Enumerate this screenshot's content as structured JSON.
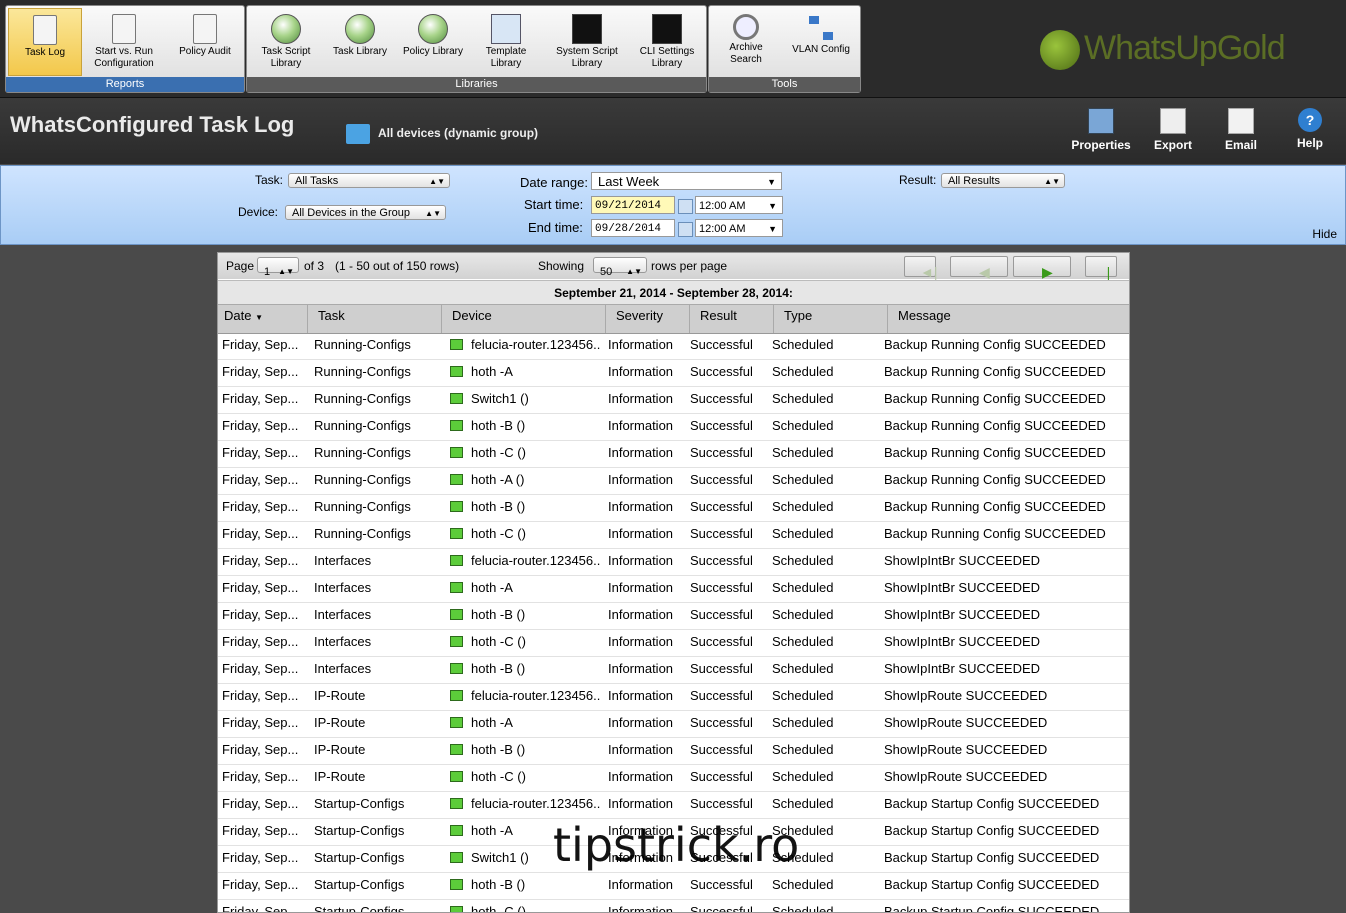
{
  "ribbon": {
    "groups": [
      {
        "label": "Reports",
        "buttons": [
          "Task Log",
          "Start vs. Run Configuration",
          "Policy Audit"
        ]
      },
      {
        "label": "Libraries",
        "buttons": [
          "Task Script Library",
          "Task Library",
          "Policy Library",
          "Template Library",
          "System Script Library",
          "CLI Settings Library"
        ]
      },
      {
        "label": "Tools",
        "buttons": [
          "Archive Search",
          "VLAN Config"
        ]
      }
    ],
    "active": "Task Log"
  },
  "logo": {
    "brand": "WhatsUpGold"
  },
  "titlebar": {
    "title": "WhatsConfigured Task Log",
    "group": "All devices (dynamic group)",
    "actions": [
      "Properties",
      "Export",
      "Email",
      "Help"
    ]
  },
  "filters": {
    "task_label": "Task:",
    "task_value": "All Tasks",
    "device_label": "Device:",
    "device_value": "All Devices in the Group",
    "date_range_label": "Date range:",
    "date_range_value": "Last Week",
    "start_label": "Start time:",
    "start_date": "09/21/2014",
    "start_time": "12:00 AM",
    "end_label": "End time:",
    "end_date": "09/28/2014",
    "end_time": "12:00 AM",
    "result_label": "Result:",
    "result_value": "All Results",
    "hide": "Hide"
  },
  "pager": {
    "page_label": "Page",
    "page_value": "1",
    "of_text": "of 3",
    "rows_info": "(1 - 50 out of 150 rows)",
    "showing_label": "Showing",
    "showing_value": "50",
    "per_page_text": "rows per page"
  },
  "range_caption": "September 21, 2014 - September 28, 2014:",
  "columns": [
    "Date",
    "Task",
    "Device",
    "Severity",
    "Result",
    "Type",
    "Message"
  ],
  "rows": [
    [
      "Friday, Sep...",
      "Running-Configs",
      "felucia-router.123456..",
      "Information",
      "Successful",
      "Scheduled",
      "Backup Running Config SUCCEEDED"
    ],
    [
      "Friday, Sep...",
      "Running-Configs",
      "hoth -A",
      "Information",
      "Successful",
      "Scheduled",
      "Backup Running Config SUCCEEDED"
    ],
    [
      "Friday, Sep...",
      "Running-Configs",
      "Switch1 ()",
      "Information",
      "Successful",
      "Scheduled",
      "Backup Running Config SUCCEEDED"
    ],
    [
      "Friday, Sep...",
      "Running-Configs",
      "hoth -B ()",
      "Information",
      "Successful",
      "Scheduled",
      "Backup Running Config SUCCEEDED"
    ],
    [
      "Friday, Sep...",
      "Running-Configs",
      "hoth -C ()",
      "Information",
      "Successful",
      "Scheduled",
      "Backup Running Config SUCCEEDED"
    ],
    [
      "Friday, Sep...",
      "Running-Configs",
      "hoth -A ()",
      "Information",
      "Successful",
      "Scheduled",
      "Backup Running Config SUCCEEDED"
    ],
    [
      "Friday, Sep...",
      "Running-Configs",
      "hoth -B ()",
      "Information",
      "Successful",
      "Scheduled",
      "Backup Running Config SUCCEEDED"
    ],
    [
      "Friday, Sep...",
      "Running-Configs",
      "hoth -C ()",
      "Information",
      "Successful",
      "Scheduled",
      "Backup Running Config SUCCEEDED"
    ],
    [
      "Friday, Sep...",
      "Interfaces",
      "felucia-router.123456..",
      "Information",
      "Successful",
      "Scheduled",
      "ShowIpIntBr SUCCEEDED"
    ],
    [
      "Friday, Sep...",
      "Interfaces",
      "hoth -A",
      "Information",
      "Successful",
      "Scheduled",
      "ShowIpIntBr SUCCEEDED"
    ],
    [
      "Friday, Sep...",
      "Interfaces",
      "hoth -B ()",
      "Information",
      "Successful",
      "Scheduled",
      "ShowIpIntBr SUCCEEDED"
    ],
    [
      "Friday, Sep...",
      "Interfaces",
      "hoth -C ()",
      "Information",
      "Successful",
      "Scheduled",
      "ShowIpIntBr SUCCEEDED"
    ],
    [
      "Friday, Sep...",
      "Interfaces",
      "hoth -B ()",
      "Information",
      "Successful",
      "Scheduled",
      "ShowIpIntBr SUCCEEDED"
    ],
    [
      "Friday, Sep...",
      "IP-Route",
      "felucia-router.123456..",
      "Information",
      "Successful",
      "Scheduled",
      "ShowIpRoute SUCCEEDED"
    ],
    [
      "Friday, Sep...",
      "IP-Route",
      "hoth -A",
      "Information",
      "Successful",
      "Scheduled",
      "ShowIpRoute SUCCEEDED"
    ],
    [
      "Friday, Sep...",
      "IP-Route",
      "hoth -B ()",
      "Information",
      "Successful",
      "Scheduled",
      "ShowIpRoute SUCCEEDED"
    ],
    [
      "Friday, Sep...",
      "IP-Route",
      "hoth -C ()",
      "Information",
      "Successful",
      "Scheduled",
      "ShowIpRoute SUCCEEDED"
    ],
    [
      "Friday, Sep...",
      "Startup-Configs",
      "felucia-router.123456..",
      "Information",
      "Successful",
      "Scheduled",
      "Backup Startup Config SUCCEEDED"
    ],
    [
      "Friday, Sep...",
      "Startup-Configs",
      "hoth -A",
      "Information",
      "Successful",
      "Scheduled",
      "Backup Startup Config SUCCEEDED"
    ],
    [
      "Friday, Sep...",
      "Startup-Configs",
      "Switch1 ()",
      "Information",
      "Successful",
      "Scheduled",
      "Backup Startup Config SUCCEEDED"
    ],
    [
      "Friday, Sep...",
      "Startup-Configs",
      "hoth -B ()",
      "Information",
      "Successful",
      "Scheduled",
      "Backup Startup Config SUCCEEDED"
    ],
    [
      "Friday, Sep...",
      "Startup-Configs",
      "hoth -C ()",
      "Information",
      "Successful",
      "Scheduled",
      "Backup Startup Config SUCCEEDED"
    ]
  ],
  "watermark": "tipstrick.ro",
  "colors": {
    "active_ribbon": "#f3c84b",
    "filter_panel": "#a9cdf5",
    "device_icon": "#5ccc3a"
  }
}
